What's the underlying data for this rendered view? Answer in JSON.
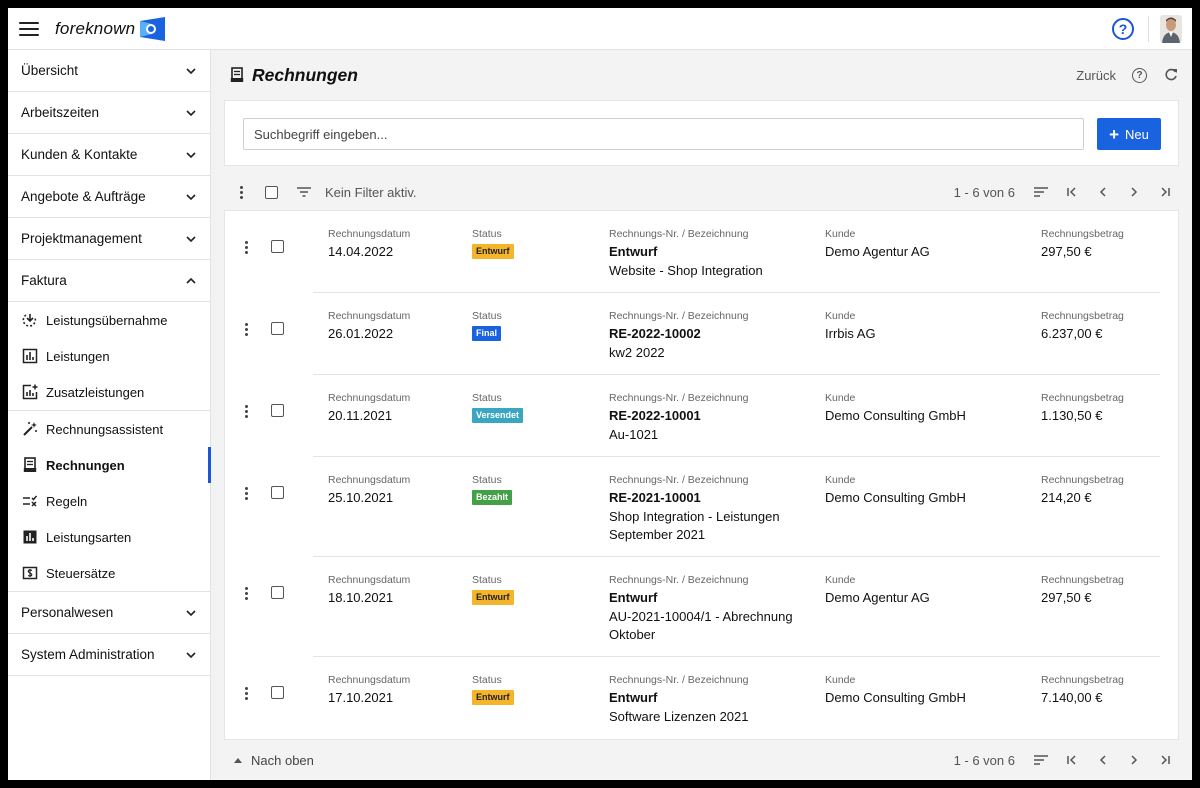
{
  "app": {
    "brand": "foreknown",
    "help_glyph": "?",
    "brand_color": "#1a63e0"
  },
  "sidebar": {
    "sections_top": [
      {
        "label": "Übersicht",
        "icon": "chevron-down-icon"
      },
      {
        "label": "Arbeitszeiten",
        "icon": "chevron-down-icon"
      },
      {
        "label": "Kunden & Kontakte",
        "icon": "chevron-down-icon"
      },
      {
        "label": "Angebote & Aufträge",
        "icon": "chevron-down-icon"
      },
      {
        "label": "Projektmanagement",
        "icon": "chevron-down-icon"
      }
    ],
    "faktura": {
      "label": "Faktura",
      "icon": "chevron-up-icon"
    },
    "faktura_items": [
      {
        "label": "Leistungsübernahme",
        "icon": "import-icon"
      },
      {
        "label": "Leistungen",
        "icon": "chart-icon"
      },
      {
        "label": "Zusatzleistungen",
        "icon": "chart-plus-icon"
      },
      {
        "label": "Rechnungsassistent",
        "icon": "magic-wand-icon"
      },
      {
        "label": "Rechnungen",
        "icon": "receipt-icon"
      },
      {
        "label": "Regeln",
        "icon": "rules-icon"
      },
      {
        "label": "Leistungsarten",
        "icon": "bar-chart-icon"
      },
      {
        "label": "Steuersätze",
        "icon": "tax-icon"
      }
    ],
    "sections_bottom": [
      {
        "label": "Personalwesen",
        "icon": "chevron-down-icon"
      },
      {
        "label": "System Administration",
        "icon": "chevron-down-icon"
      }
    ]
  },
  "page": {
    "title": "Rechnungen",
    "back_label": "Zurück",
    "help_glyph": "?"
  },
  "search": {
    "placeholder": "Suchbegriff eingeben...",
    "new_label": "Neu"
  },
  "toolbar": {
    "filter_text": "Kein Filter aktiv.",
    "count": "1 - 6 von 6"
  },
  "columns": {
    "date": "Rechnungsdatum",
    "status": "Status",
    "number": "Rechnungs-Nr. / Bezeichnung",
    "customer": "Kunde",
    "amount": "Rechnungsbetrag"
  },
  "invoices": [
    {
      "date": "14.04.2022",
      "status": "Entwurf",
      "status_key": "entwurf",
      "number": "Entwurf",
      "desc": "Website - Shop Integration",
      "customer": "Demo Agentur AG",
      "amount": "297,50 €"
    },
    {
      "date": "26.01.2022",
      "status": "Final",
      "status_key": "final",
      "number": "RE-2022-10002",
      "desc": "kw2 2022",
      "customer": "Irrbis AG",
      "amount": "6.237,00 €"
    },
    {
      "date": "20.11.2021",
      "status": "Versendet",
      "status_key": "versendet",
      "number": "RE-2022-10001",
      "desc": "Au-1021",
      "customer": "Demo Consulting GmbH",
      "amount": "1.130,50 €"
    },
    {
      "date": "25.10.2021",
      "status": "Bezahlt",
      "status_key": "bezahlt",
      "number": "RE-2021-10001",
      "desc": "Shop Integration - Leistungen September 2021",
      "customer": "Demo Consulting GmbH",
      "amount": "214,20 €"
    },
    {
      "date": "18.10.2021",
      "status": "Entwurf",
      "status_key": "entwurf",
      "number": "Entwurf",
      "desc": "AU-2021-10004/1 - Abrechnung Oktober",
      "customer": "Demo Agentur AG",
      "amount": "297,50 €"
    },
    {
      "date": "17.10.2021",
      "status": "Entwurf",
      "status_key": "entwurf",
      "number": "Entwurf",
      "desc": "Software Lizenzen 2021",
      "customer": "Demo Consulting GmbH",
      "amount": "7.140,00 €"
    }
  ],
  "footer": {
    "up_label": "Nach oben",
    "count": "1 - 6 von 6"
  },
  "status_colors": {
    "entwurf": "#f4b52a",
    "final": "#1a63e0",
    "versendet": "#3aa6c0",
    "bezahlt": "#43a047"
  }
}
